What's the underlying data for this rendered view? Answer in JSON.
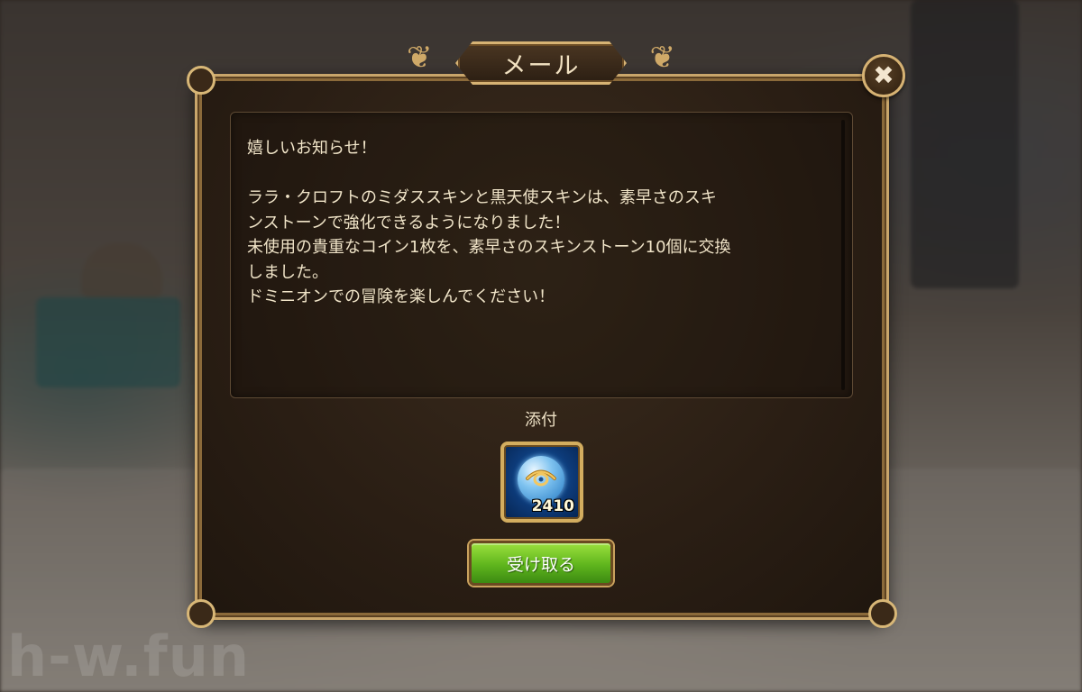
{
  "watermark": "h-w.fun",
  "dialog": {
    "title": "メール",
    "close_icon": "close-icon",
    "message_lines": [
      "嬉しいお知らせ！",
      "",
      "ララ・クロフトのミダススキンと黒天使スキンは、素早さのスキ",
      "ンストーンで強化できるようになりました！",
      "未使用の貴重なコイン1枚を、素早さのスキンストーン10個に交換",
      "しました。",
      "ドミニオンでの冒険を楽しんでください！"
    ],
    "attachment_label": "添付",
    "attachment": {
      "icon": "skin-stone-eye-icon",
      "count": "2410"
    },
    "receive_button": "受け取る"
  },
  "colors": {
    "frame_gold": "#c9a66b",
    "button_green": "#5fb51d",
    "text_cream": "#f0e4c8"
  }
}
